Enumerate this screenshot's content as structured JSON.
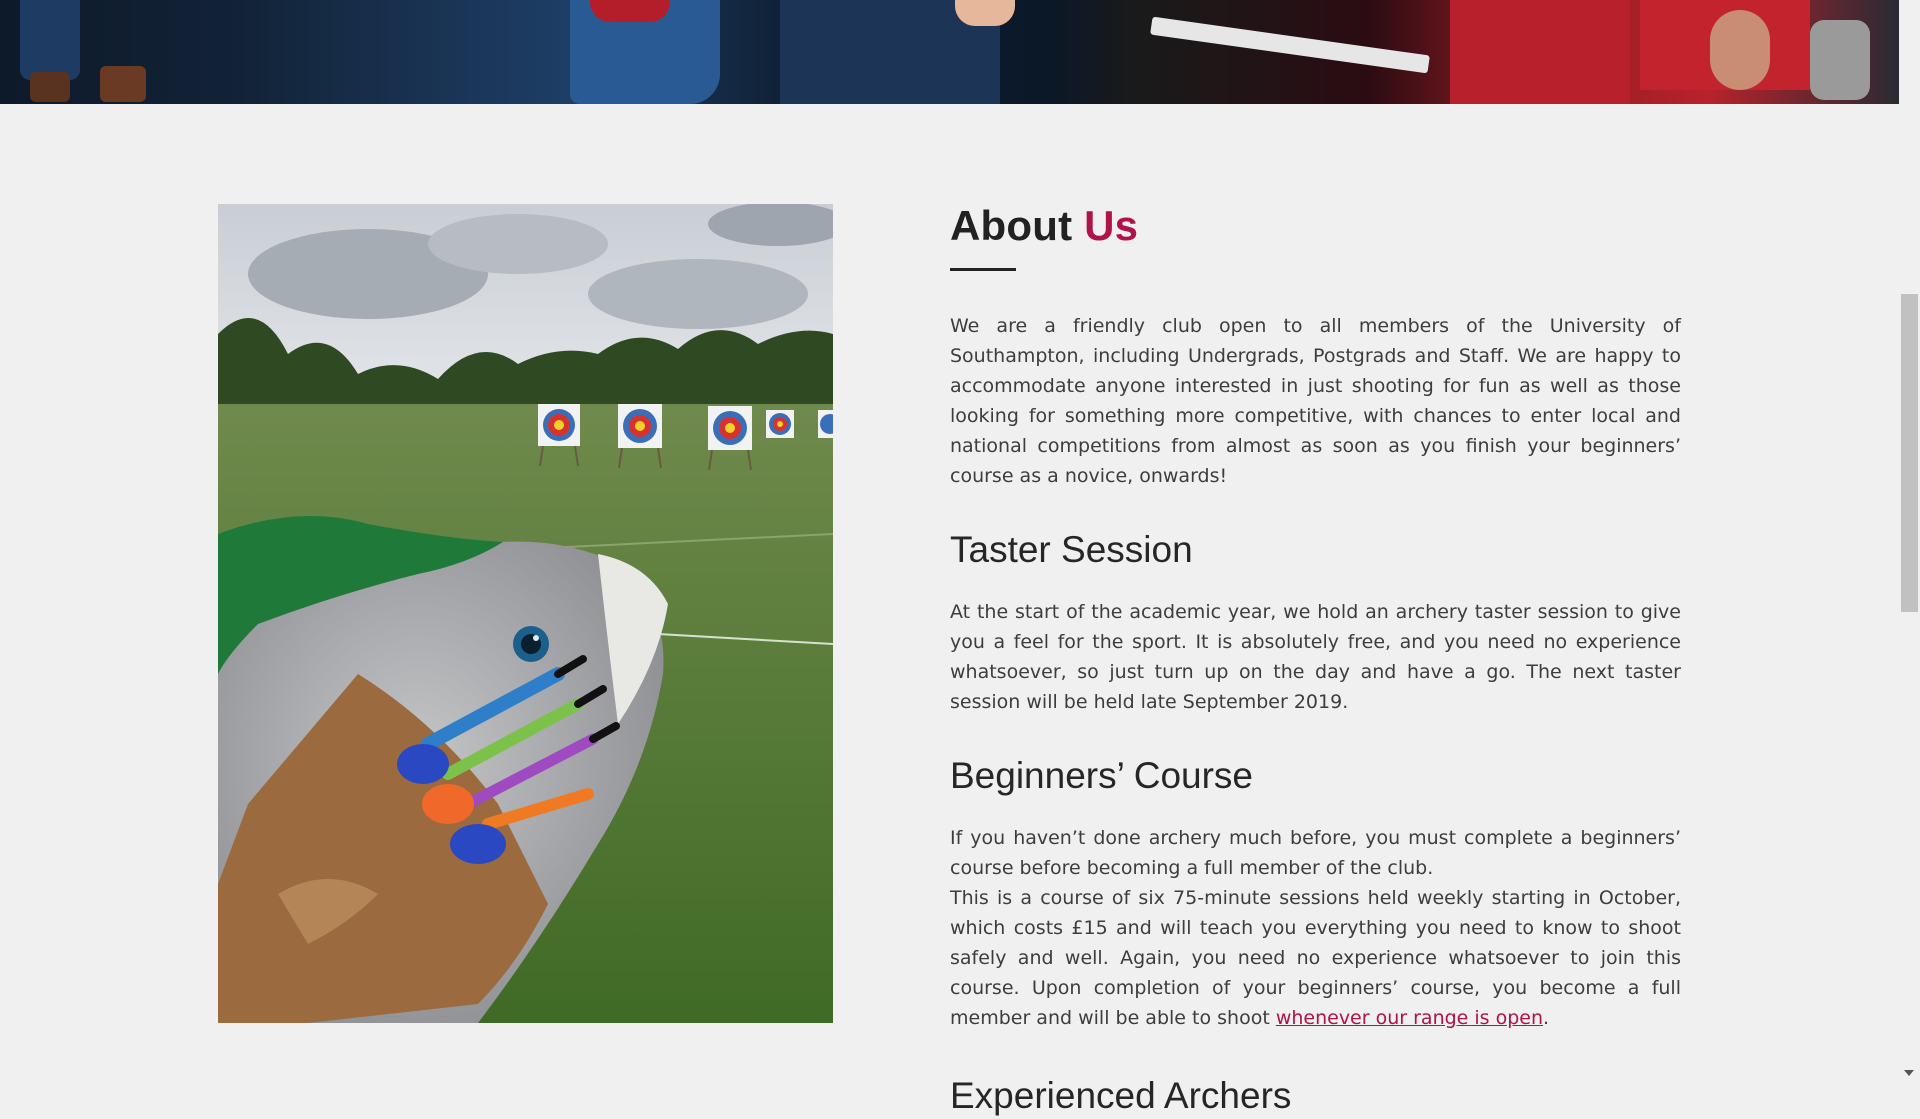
{
  "about": {
    "title_main": "About ",
    "title_accent": "Us",
    "body": "We are a friendly club open to all members of the University of Southampton, including Undergrads, Postgrads and Staff. We are happy to accommodate anyone interested in just shooting for fun as well as those looking for something more competitive, with chances to enter local and national competitions from almost as soon as you finish your beginners’ course as a novice, onwards!"
  },
  "taster": {
    "title": "Taster Session",
    "body": "At the start of the academic year, we hold an archery taster session to give you a feel for the sport. It is absolutely free, and you need no experience whatsoever, so just turn up on the day and have a go. The next taster session will be held late September 2019."
  },
  "beginners": {
    "title": "Beginners’ Course",
    "body1": "If you haven’t done archery much before, you must complete a beginners’ course before becoming a full member of the club.",
    "body2_pre": "This is a course of six 75-minute sessions held weekly starting in October, which costs £15 and will teach you everything you need to know to shoot safely and well. Again, you need no experience whatsoever to join this course. Upon completion of your beginners’ course, you become a full member and will be able to shoot ",
    "link_text": "whenever our range is open",
    "body2_post": "."
  },
  "experienced": {
    "title": "Experienced Archers"
  },
  "colors": {
    "accent": "#b0124a",
    "background": "#eff0ef",
    "text": "#3d3d3d"
  }
}
